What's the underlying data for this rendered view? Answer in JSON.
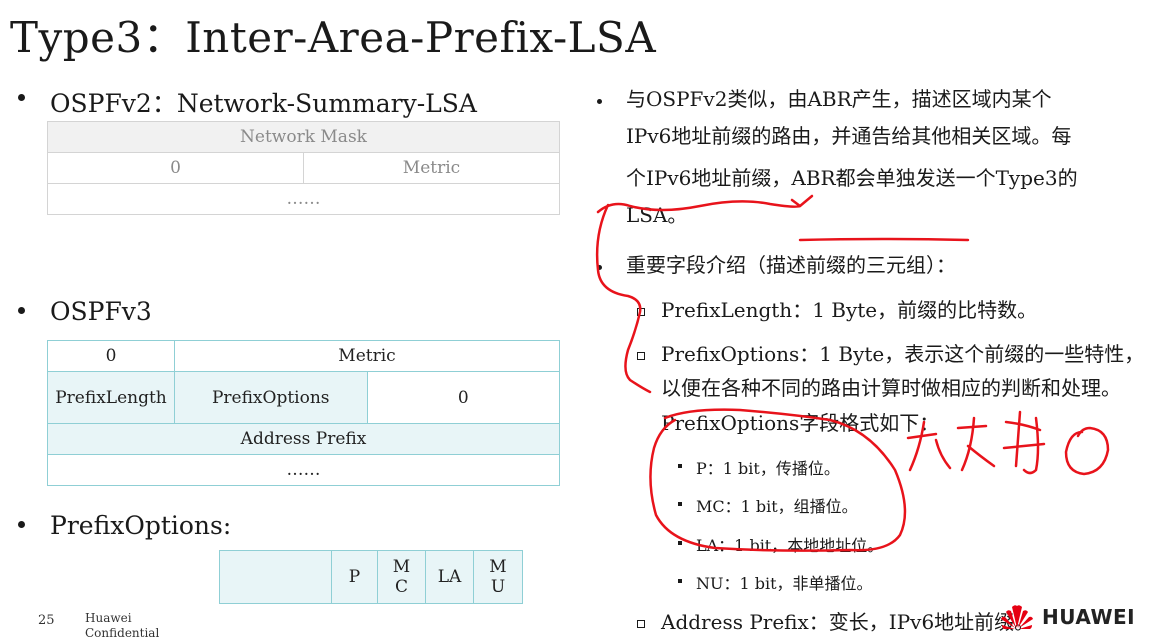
{
  "title": "Type3：Inter-Area-Prefix-LSA",
  "left": {
    "v2_heading": "OSPFv2：Network-Summary-LSA",
    "v2_table": {
      "mask": "Network Mask",
      "zero": "0",
      "metric": "Metric",
      "more": "……"
    },
    "v3_heading": "OSPFv3",
    "v3_table": {
      "zero": "0",
      "metric": "Metric",
      "prefix_length": "PrefixLength",
      "prefix_options": "PrefixOptions",
      "zero2": "0",
      "address_prefix": "Address Prefix",
      "more": "……"
    },
    "options_heading": "PrefixOptions:",
    "options_table": [
      "",
      "P",
      "MC",
      "LA",
      "MU"
    ]
  },
  "right": {
    "para1_l1": "与OSPFv2类似，由ABR产生，描述区域内某个",
    "para1_l2": "IPv6地址前缀的路由，并通告给其他相关区域。每",
    "para1_l3": "个IPv6地址前缀，ABR都会单独发送一个Type3的",
    "para1_l4": "LSA。",
    "para2": "重要字段介绍（描述前缀的三元组）：",
    "sub1": "PrefixLength：1 Byte，前缀的比特数。",
    "sub2_l1": "PrefixOptions：1 Byte，表示这个前缀的一些特性，",
    "sub2_l2": "以便在各种不同的路由计算时做相应的判断和处理。",
    "sub2_l3": "PrefixOptions字段格式如下：",
    "opt_p": "P：1 bit，传播位。",
    "opt_mc": "MC：1 bit，组播位。",
    "opt_la": "LA：1 bit，本地地址位。",
    "opt_nu": "NU：1 bit，非单播位。",
    "sub3": "Address Prefix：变长，IPv6地址前缀。"
  },
  "footer": {
    "page": "25",
    "company": "Huawei Confidential",
    "logo_text": "HUAWEI"
  },
  "annotation_color": "#e8131b",
  "logo_color": "#e60012"
}
